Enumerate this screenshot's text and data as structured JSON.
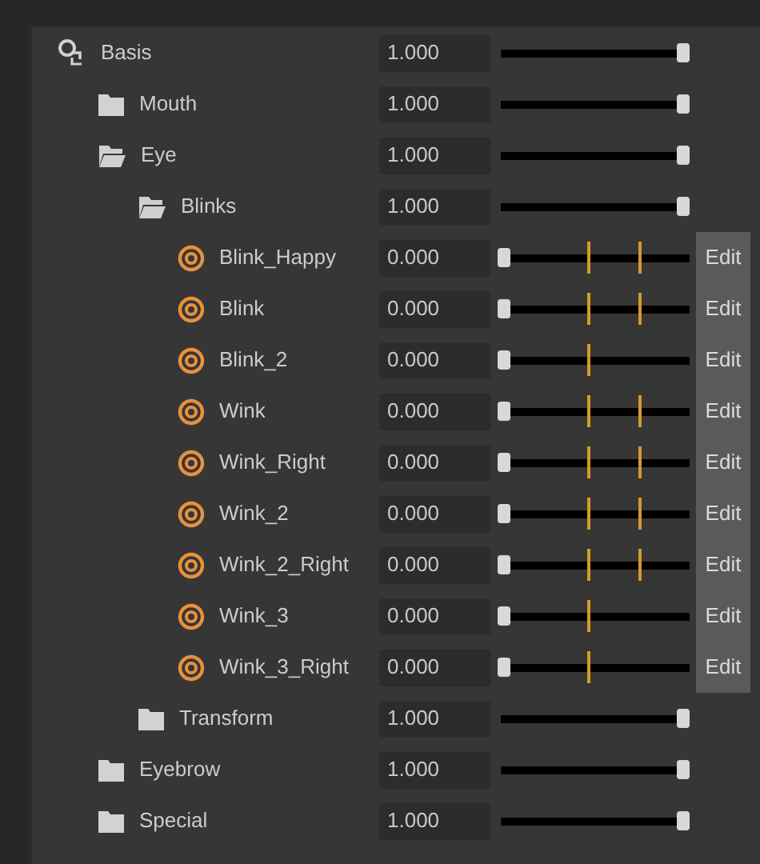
{
  "tree": [
    {
      "kind": "root",
      "name": "Basis",
      "value": "1.000",
      "level": 1,
      "expanded": true,
      "children": [
        {
          "kind": "folder",
          "name": "Mouth",
          "value": "1.000",
          "level": 1,
          "expanded": false
        },
        {
          "kind": "folder",
          "name": "Eye",
          "value": "1.000",
          "level": 1,
          "expanded": true,
          "children": [
            {
              "kind": "folder",
              "name": "Blinks",
              "value": "1.000",
              "level": 1,
              "expanded": true,
              "children": [
                {
                  "kind": "shape",
                  "name": "Blink_Happy",
                  "value": "0.000",
                  "level": 0,
                  "markers": [
                    {
                      "level": 0.48
                    },
                    {
                      "level": 0.78
                    }
                  ],
                  "button": "Edit"
                },
                {
                  "kind": "shape",
                  "name": "Blink",
                  "value": "0.000",
                  "level": 0,
                  "markers": [
                    {
                      "level": 0.48
                    },
                    {
                      "level": 0.78
                    }
                  ],
                  "button": "Edit"
                },
                {
                  "kind": "shape",
                  "name": "Blink_2",
                  "value": "0.000",
                  "level": 0,
                  "markers": [
                    {
                      "level": 0.48
                    }
                  ],
                  "button": "Edit"
                },
                {
                  "kind": "shape",
                  "name": "Wink",
                  "value": "0.000",
                  "level": 0,
                  "markers": [
                    {
                      "level": 0.48
                    },
                    {
                      "level": 0.78
                    }
                  ],
                  "button": "Edit"
                },
                {
                  "kind": "shape",
                  "name": "Wink_Right",
                  "value": "0.000",
                  "level": 0,
                  "markers": [
                    {
                      "level": 0.48
                    },
                    {
                      "level": 0.78
                    }
                  ],
                  "button": "Edit"
                },
                {
                  "kind": "shape",
                  "name": "Wink_2",
                  "value": "0.000",
                  "level": 0,
                  "markers": [
                    {
                      "level": 0.48
                    },
                    {
                      "level": 0.78
                    }
                  ],
                  "button": "Edit"
                },
                {
                  "kind": "shape",
                  "name": "Wink_2_Right",
                  "value": "0.000",
                  "level": 0,
                  "markers": [
                    {
                      "level": 0.48
                    },
                    {
                      "level": 0.78
                    }
                  ],
                  "button": "Edit"
                },
                {
                  "kind": "shape",
                  "name": "Wink_3",
                  "value": "0.000",
                  "level": 0,
                  "markers": [
                    {
                      "level": 0.48
                    }
                  ],
                  "button": "Edit"
                },
                {
                  "kind": "shape",
                  "name": "Wink_3_Right",
                  "value": "0.000",
                  "level": 0,
                  "markers": [
                    {
                      "level": 0.48
                    }
                  ],
                  "button": "Edit"
                }
              ]
            },
            {
              "kind": "folder",
              "name": "Transform",
              "value": "1.000",
              "level": 1,
              "expanded": false
            }
          ]
        },
        {
          "kind": "folder",
          "name": "Eyebrow",
          "value": "1.000",
          "level": 1,
          "expanded": false
        },
        {
          "kind": "folder",
          "name": "Special",
          "value": "1.000",
          "level": 1,
          "expanded": false
        }
      ]
    }
  ]
}
